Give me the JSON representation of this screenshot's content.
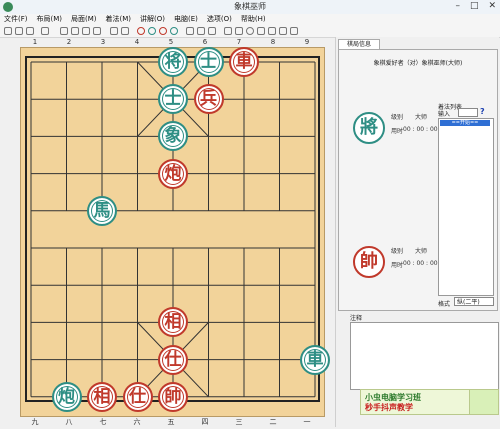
{
  "window": {
    "title": "象棋巫师"
  },
  "menu": [
    "文件(F)",
    "布局(M)",
    "局面(M)",
    "着法(M)",
    "讲解(O)",
    "电脑(E)",
    "选项(O)",
    "帮助(H)"
  ],
  "ruler": {
    "top": [
      "1",
      "2",
      "3",
      "4",
      "5",
      "6",
      "7",
      "8",
      "9"
    ],
    "bottom": [
      "九",
      "八",
      "七",
      "六",
      "五",
      "四",
      "三",
      "二",
      "一"
    ]
  },
  "pieces": [
    {
      "side": "black",
      "label": "将",
      "col": 5,
      "row": 0
    },
    {
      "side": "black",
      "label": "士",
      "col": 6,
      "row": 0
    },
    {
      "side": "red",
      "label": "車",
      "col": 7,
      "row": 0
    },
    {
      "side": "black",
      "label": "士",
      "col": 5,
      "row": 1
    },
    {
      "side": "red",
      "label": "兵",
      "col": 6,
      "row": 1
    },
    {
      "side": "black",
      "label": "象",
      "col": 5,
      "row": 2
    },
    {
      "side": "red",
      "label": "炮",
      "col": 5,
      "row": 3
    },
    {
      "side": "black",
      "label": "馬",
      "col": 3,
      "row": 4
    },
    {
      "side": "red",
      "label": "相",
      "col": 5,
      "row": 7
    },
    {
      "side": "red",
      "label": "仕",
      "col": 5,
      "row": 8
    },
    {
      "side": "black",
      "label": "車",
      "col": 9,
      "row": 8
    },
    {
      "side": "black",
      "label": "炮",
      "col": 2,
      "row": 9
    },
    {
      "side": "red",
      "label": "相",
      "col": 3,
      "row": 9
    },
    {
      "side": "red",
      "label": "仕",
      "col": 4,
      "row": 9
    },
    {
      "side": "red",
      "label": "帥",
      "col": 5,
      "row": 9
    }
  ],
  "panel": {
    "tab_label": "棋局信息",
    "match_title": "象棋爱好者（对）象棋巫师(大师)",
    "black_piece": "將",
    "red_piece": "帥",
    "black_info": {
      "level_label": "级别",
      "level_value": "大师",
      "time_label": "用时",
      "time_value": "00 : 00 : 00"
    },
    "red_info": {
      "level_label": "级别",
      "level_value": "大师",
      "time_label": "用时",
      "time_value": "00 : 00 : 00"
    },
    "moves": {
      "title": "着法列表",
      "input_label": "输入",
      "help": "?",
      "selected": "==开始=="
    },
    "format": {
      "label": "格式",
      "value": "纵(二平)"
    },
    "notes_label": "注释",
    "ad_line1": "小虫电脑学习班",
    "ad_line2": "秒手抖声教学"
  },
  "colors": {
    "board": "#f2d39a",
    "red": "#c0392b",
    "black": "#2e8e84"
  }
}
